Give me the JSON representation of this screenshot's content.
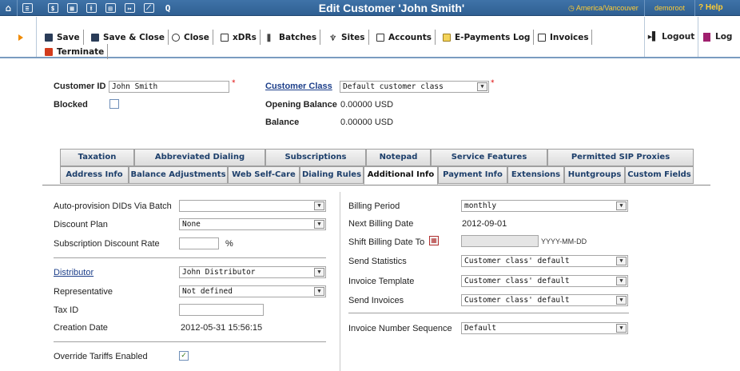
{
  "topbar": {
    "icons": [
      "home-icon",
      "list-icon",
      "dollar-icon",
      "grid-icon",
      "person-icon",
      "card-icon",
      "transfer-icon",
      "chart-icon",
      "search-icon"
    ],
    "title": "Edit Customer 'John Smith'",
    "timezone": "America/Vancouver",
    "user": "demoroot",
    "help": "Help"
  },
  "toolbar": {
    "save": "Save",
    "save_close": "Save & Close",
    "close": "Close",
    "xdrs": "xDRs",
    "batches": "Batches",
    "sites": "Sites",
    "accounts": "Accounts",
    "epayments": "E-Payments Log",
    "invoices": "Invoices",
    "terminate": "Terminate",
    "logout": "Logout",
    "log": "Log"
  },
  "header": {
    "customer_id_label": "Customer ID",
    "customer_id_value": "John Smith",
    "blocked_label": "Blocked",
    "customer_class_label": "Customer Class",
    "customer_class_value": "Default customer class",
    "opening_balance_label": "Opening Balance",
    "opening_balance_value": "0.00000 USD",
    "balance_label": "Balance",
    "balance_value": "0.00000 USD"
  },
  "tabs_row1": [
    "Taxation",
    "Abbreviated Dialing",
    "Subscriptions",
    "Notepad",
    "Service Features",
    "Permitted SIP Proxies"
  ],
  "tabs_row2": [
    "Address Info",
    "Balance Adjustments",
    "Web Self-Care",
    "Dialing Rules",
    "Additional Info",
    "Payment Info",
    "Extensions",
    "Huntgroups",
    "Custom Fields"
  ],
  "left": {
    "auto_provision_label": "Auto-provision DIDs Via Batch",
    "auto_provision_value": "",
    "discount_plan_label": "Discount Plan",
    "discount_plan_value": "None",
    "subscription_discount_label": "Subscription Discount Rate",
    "subscription_discount_value": "",
    "percent": "%",
    "distributor_label": "Distributor",
    "distributor_value": "John Distributor",
    "representative_label": "Representative",
    "representative_value": "Not defined",
    "tax_id_label": "Tax ID",
    "tax_id_value": "",
    "creation_date_label": "Creation Date",
    "creation_date_value": "2012-05-31 15:56:15",
    "override_tariffs_label": "Override Tariffs Enabled",
    "override_tariffs_checked": true
  },
  "right": {
    "billing_period_label": "Billing Period",
    "billing_period_value": "monthly",
    "next_billing_label": "Next Billing Date",
    "next_billing_value": "2012-09-01",
    "shift_billing_label": "Shift Billing Date To",
    "shift_billing_value": "",
    "date_format": "YYYY-MM-DD",
    "send_statistics_label": "Send Statistics",
    "send_statistics_value": "Customer class' default",
    "invoice_template_label": "Invoice Template",
    "invoice_template_value": "Customer class' default",
    "send_invoices_label": "Send Invoices",
    "send_invoices_value": "Customer class' default",
    "invoice_seq_label": "Invoice Number Sequence",
    "invoice_seq_value": "Default"
  },
  "colors": {
    "topbar": "#3f73a8",
    "accent": "#ffcc33",
    "link": "#1d3f8a"
  }
}
